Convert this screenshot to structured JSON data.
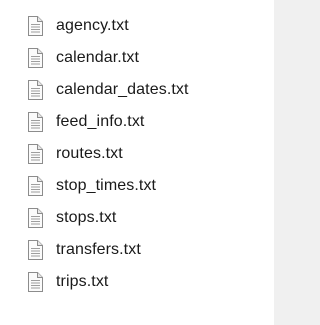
{
  "file_list": {
    "items": [
      {
        "name": "agency.txt",
        "icon": "text-file-icon"
      },
      {
        "name": "calendar.txt",
        "icon": "text-file-icon"
      },
      {
        "name": "calendar_dates.txt",
        "icon": "text-file-icon"
      },
      {
        "name": "feed_info.txt",
        "icon": "text-file-icon"
      },
      {
        "name": "routes.txt",
        "icon": "text-file-icon"
      },
      {
        "name": "stop_times.txt",
        "icon": "text-file-icon"
      },
      {
        "name": "stops.txt",
        "icon": "text-file-icon"
      },
      {
        "name": "transfers.txt",
        "icon": "text-file-icon"
      },
      {
        "name": "trips.txt",
        "icon": "text-file-icon"
      }
    ]
  }
}
